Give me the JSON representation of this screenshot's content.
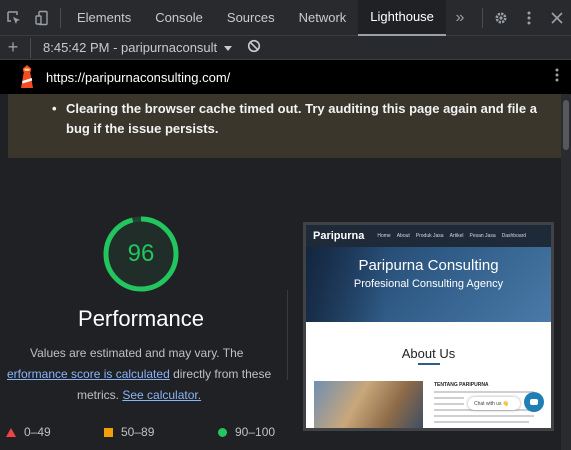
{
  "devtools": {
    "tabs": [
      "Elements",
      "Console",
      "Sources",
      "Network",
      "Lighthouse"
    ],
    "active_tab": "Lighthouse",
    "more_tabs_glyph": "»",
    "icons": [
      "inspect-element-icon",
      "device-toolbar-icon",
      "settings-gear-icon",
      "more-vertical-icon",
      "close-icon"
    ]
  },
  "lighthouse": {
    "report_label": "8:45:42 PM - paripurnaconsult",
    "url": "https://paripurnaconsulting.com/",
    "warning": "Clearing the browser cache timed out. Try auditing this page again and file a bug if the issue persists.",
    "score": "96",
    "score_fraction": 0.96,
    "category": "Performance",
    "desc_line1": "Values are estimated and may vary. The",
    "desc_link1": "erformance score is calculated",
    "desc_line2_rest": " directly from these",
    "desc_line3_start": "metrics.",
    "desc_link2": "See calculator.",
    "legend": [
      "0–49",
      "50–89",
      "90–100"
    ],
    "colors": {
      "pass": "#22c55e",
      "average": "#f59e0b",
      "fail": "#ef4444",
      "link": "#8ab4f8"
    }
  },
  "screenshot": {
    "brand": "Paripurna",
    "nav_items": [
      "Home",
      "About",
      "Produk Jasa",
      "Artikel",
      "Pesan Jasa",
      "Dashboard"
    ],
    "hero_title": "Paripurna Consulting",
    "hero_subtitle": "Profesional Consulting Agency",
    "about_heading": "About Us",
    "section_label": "TENTANG PARIPURNA",
    "chat_label": "Chat with us 👋"
  }
}
